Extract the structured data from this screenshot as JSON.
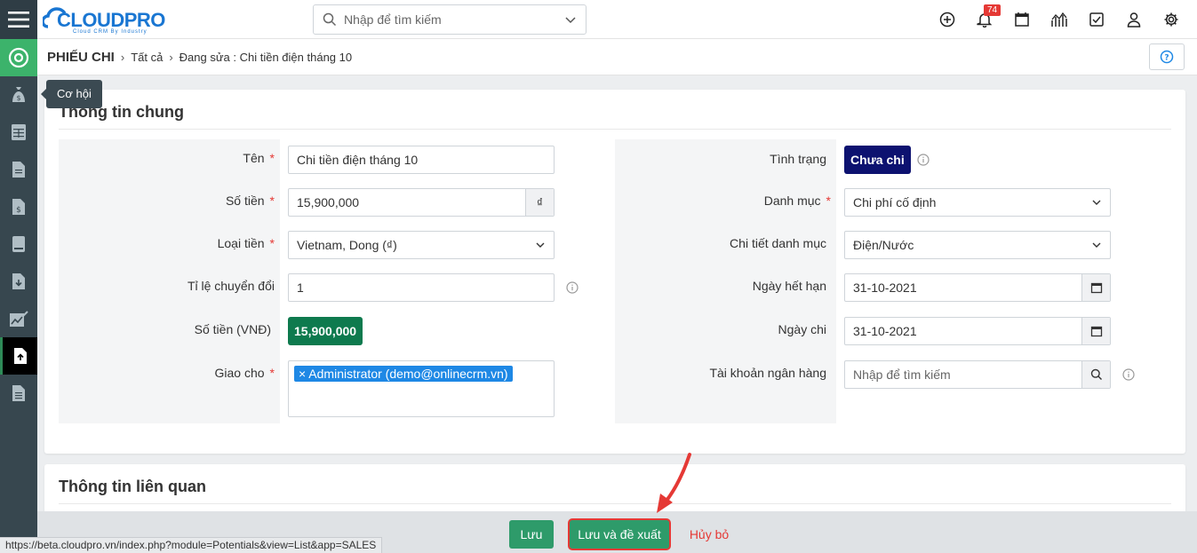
{
  "logo": {
    "text": "CLOUDPRO",
    "tagline": "Cloud CRM By Industry"
  },
  "search": {
    "placeholder": "Nhập để tìm kiếm"
  },
  "notifications": {
    "count": "74"
  },
  "breadcrumb": {
    "module": "PHIẾU CHI",
    "all": "Tất cả",
    "current": "Đang sửa : Chi tiền điện tháng 10"
  },
  "tooltip": {
    "text": "Cơ hội"
  },
  "section1": {
    "title": "Thông tin chung"
  },
  "section2": {
    "title": "Thông tin liên quan"
  },
  "left_fields": {
    "name": {
      "label": "Tên",
      "value": "Chi tiền điện tháng 10"
    },
    "amount": {
      "label": "Số tiền",
      "value": "15,900,000",
      "unit": "₫"
    },
    "currency": {
      "label": "Loại tiền",
      "value": "Vietnam, Dong (₫)"
    },
    "rate": {
      "label": "Tỉ lệ chuyển đổi",
      "value": "1"
    },
    "vnd": {
      "label": "Số tiền (VNĐ)",
      "value": "15,900,000"
    },
    "assigned": {
      "label": "Giao cho",
      "value": "× Administrator (demo@onlinecrm.vn)"
    }
  },
  "right_fields": {
    "status": {
      "label": "Tình trạng",
      "value": "Chưa chi"
    },
    "category": {
      "label": "Danh mục",
      "value": "Chi phí cố định"
    },
    "subcategory": {
      "label": "Chi tiết danh mục",
      "value": "Điện/Nước"
    },
    "due_date": {
      "label": "Ngày hết hạn",
      "value": "31-10-2021"
    },
    "pay_date": {
      "label": "Ngày chi",
      "value": "31-10-2021"
    },
    "bank": {
      "label": "Tài khoản ngân hàng",
      "placeholder": "Nhập để tìm kiếm"
    }
  },
  "required_mark": "*",
  "footer": {
    "save": "Lưu",
    "save_propose": "Lưu và đề xuất",
    "cancel": "Hủy bỏ"
  },
  "status_url": "https://beta.cloudpro.vn/index.php?module=Potentials&view=List&app=SALES",
  "colors": {
    "sidebar": "#37474f",
    "primary": "#2e9b6a",
    "status_chip": "#0d1270",
    "vnd_chip": "#0e7a4e",
    "tag": "#1e88e5",
    "danger": "#e53935"
  }
}
